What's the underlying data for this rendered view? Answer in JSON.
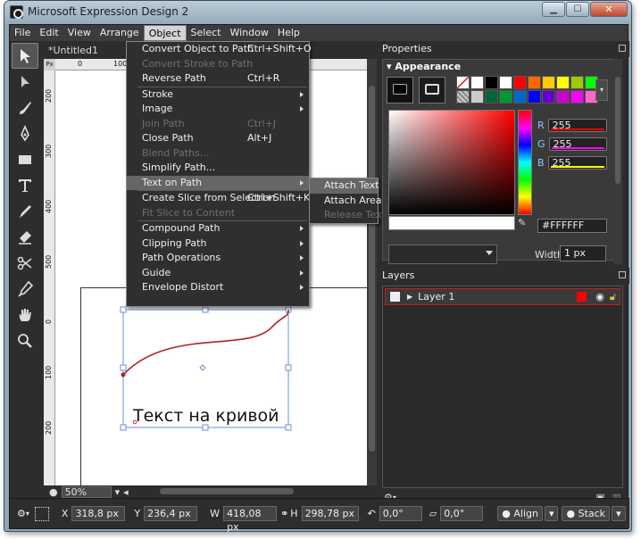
{
  "window": {
    "title": "Microsoft Expression Design 2"
  },
  "menubar": {
    "items": [
      "File",
      "Edit",
      "View",
      "Arrange",
      "Object",
      "Select",
      "Window",
      "Help"
    ],
    "active": "Object"
  },
  "document": {
    "tab": "*Untitled1",
    "ruler_unit": "Px",
    "h_ticks": [
      "0",
      "100"
    ],
    "v_ticks": [
      "200",
      "300",
      "400",
      "500",
      "0",
      "100",
      "200"
    ],
    "canvas_text": "Текст на кривой",
    "zoom": "50%"
  },
  "object_menu": {
    "items": [
      {
        "label": "Convert Object to Path",
        "shortcut": "Ctrl+Shift+O",
        "enabled": true
      },
      {
        "label": "Convert Stroke to Path",
        "shortcut": "",
        "enabled": false
      },
      {
        "label": "Reverse Path",
        "shortcut": "Ctrl+R",
        "enabled": true
      },
      {
        "label": "Stroke",
        "shortcut": "",
        "enabled": true,
        "submenu": true,
        "sep_before": true
      },
      {
        "label": "Image",
        "shortcut": "",
        "enabled": true,
        "submenu": true
      },
      {
        "label": "Join Path",
        "shortcut": "Ctrl+J",
        "enabled": false
      },
      {
        "label": "Close Path",
        "shortcut": "Alt+J",
        "enabled": true
      },
      {
        "label": "Blend Paths...",
        "shortcut": "",
        "enabled": false
      },
      {
        "label": "Simplify Path...",
        "shortcut": "",
        "enabled": true
      },
      {
        "label": "Text on Path",
        "shortcut": "",
        "enabled": true,
        "submenu": true,
        "highlighted": true
      },
      {
        "label": "Create Slice from Selection",
        "shortcut": "Ctrl+Shift+K",
        "enabled": true,
        "sep_before": true
      },
      {
        "label": "Fit Slice to Content",
        "shortcut": "",
        "enabled": false
      },
      {
        "label": "Compound Path",
        "shortcut": "",
        "enabled": true,
        "submenu": true,
        "sep_before": true
      },
      {
        "label": "Clipping Path",
        "shortcut": "",
        "enabled": true,
        "submenu": true
      },
      {
        "label": "Path Operations",
        "shortcut": "",
        "enabled": true,
        "submenu": true
      },
      {
        "label": "Guide",
        "shortcut": "",
        "enabled": true,
        "submenu": true
      },
      {
        "label": "Envelope Distort",
        "shortcut": "",
        "enabled": true,
        "submenu": true
      }
    ]
  },
  "text_on_path_submenu": {
    "items": [
      {
        "label": "Attach Text",
        "enabled": true,
        "highlighted": true
      },
      {
        "label": "Attach Area Text",
        "enabled": true
      },
      {
        "label": "Release Text",
        "enabled": false
      }
    ]
  },
  "properties": {
    "title": "Properties",
    "appearance": "Appearance",
    "r": {
      "label": "R",
      "value": "255"
    },
    "g": {
      "label": "G",
      "value": "255"
    },
    "b": {
      "label": "B",
      "value": "255"
    },
    "hex": "#FFFFFF",
    "width_label": "Width",
    "width_value": "1 px",
    "swatches": [
      "none",
      "#ffffff",
      "#000000",
      "#ffffff",
      "#ff0000",
      "#ff6600",
      "#ffcc00",
      "#ffff00",
      "#99cc00",
      "#00ff00",
      "pattern",
      "#cccccc",
      "#006633",
      "#009933",
      "#0066cc",
      "#0000ff",
      "#6600cc",
      "#cc00cc",
      "#ff00ff",
      "#ff66cc"
    ]
  },
  "layers": {
    "title": "Layers",
    "items": [
      {
        "name": "Layer 1",
        "color": "#ff0000"
      }
    ]
  },
  "statusbar": {
    "x": {
      "label": "X",
      "value": "318,8 px"
    },
    "y": {
      "label": "Y",
      "value": "236,4 px"
    },
    "w": {
      "label": "W",
      "value": "418,08 px"
    },
    "h": {
      "label": "H",
      "value": "298,78 px"
    },
    "rotate": "0,0°",
    "skew": "0,0°",
    "align": "Align",
    "stack": "Stack"
  }
}
